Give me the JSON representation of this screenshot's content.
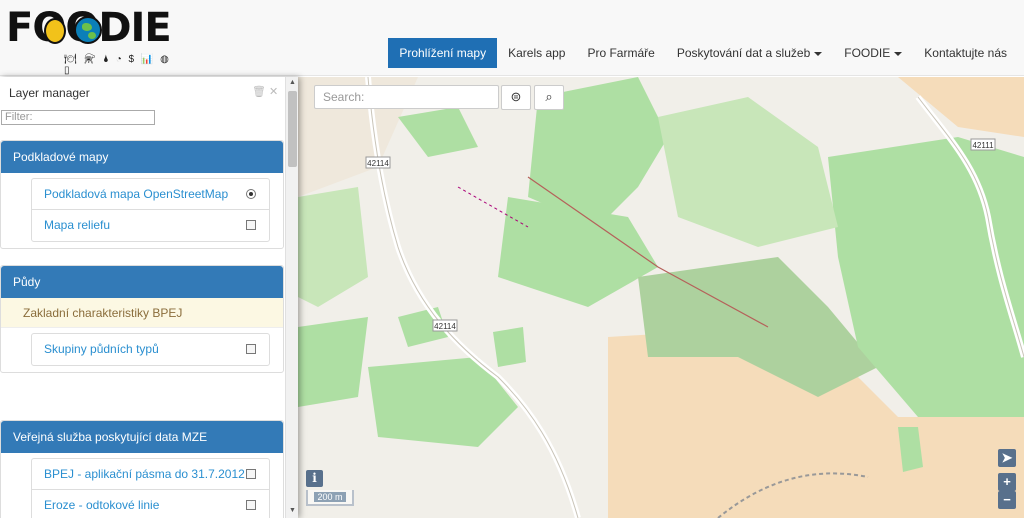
{
  "header": {
    "logo_text": "FOODIE",
    "logo_icons": "🍽 ⚗ 🌢 ◔ $ 📊 ◍ ▯",
    "nav": [
      {
        "label": "Prohlížení mapy",
        "active": true
      },
      {
        "label": "Karels app"
      },
      {
        "label": "Pro Farmáře"
      },
      {
        "label": "Poskytování dat a služeb",
        "dropdown": true
      },
      {
        "label": "FOODIE",
        "dropdown": true
      },
      {
        "label": "Kontaktujte nás"
      }
    ]
  },
  "map": {
    "search_placeholder": "Search:",
    "road_labels": [
      "42114",
      "42114",
      "42111"
    ],
    "scale_label": "200 m",
    "colors": {
      "land": "#f1efe9",
      "vineyard": "#aedfa3",
      "forest": "#add19e",
      "farmland": "#f5dcba",
      "accent": "#1f6fb4"
    }
  },
  "layer_manager": {
    "title": "Layer manager",
    "filter_placeholder": "Filter:",
    "groups": [
      {
        "title": "Podkladové mapy",
        "items": [
          {
            "label": "Podkladová mapa OpenStreetMap",
            "control": "radio",
            "checked": true
          },
          {
            "label": "Mapa reliefu",
            "control": "checkbox",
            "checked": false
          }
        ]
      },
      {
        "title": "Půdy",
        "subheading": "Zakladní charakteristiky BPEJ",
        "items": [
          {
            "label": "Skupiny půdních typů",
            "control": "checkbox",
            "checked": false
          }
        ]
      },
      {
        "title": "Veřejná služba poskytující data MZE",
        "items": [
          {
            "label": "BPEJ - aplikační pásma do 31.7.2012",
            "control": "checkbox",
            "checked": false
          },
          {
            "label": "Eroze - odtokové linie",
            "control": "checkbox",
            "checked": false
          }
        ]
      }
    ]
  }
}
